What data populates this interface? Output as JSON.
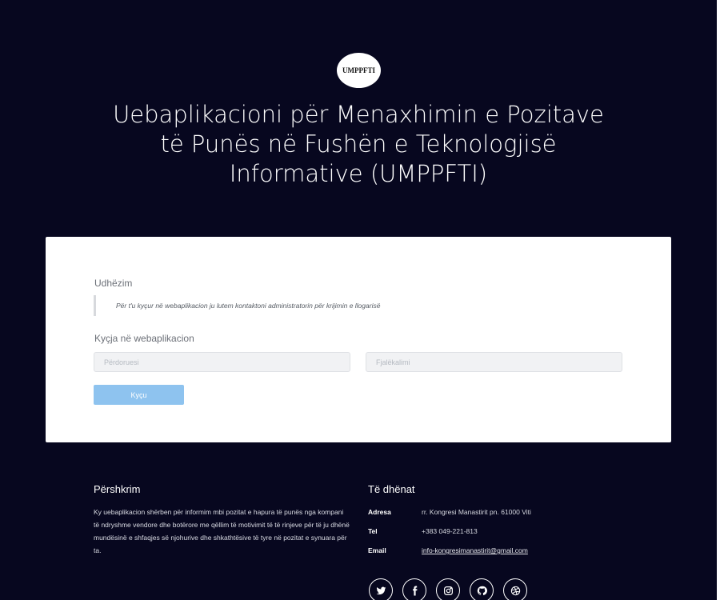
{
  "logo": {
    "text": "UMPPFTI"
  },
  "hero": {
    "title_lines": [
      "Uebaplikacioni për Menaxhimin e Pozitave",
      "të Punës në Fushën e Teknologjisë",
      "Informative (UMPPFTI)"
    ]
  },
  "guide": {
    "label": "Udhëzim",
    "text": "Për t'u kyçur në webaplikacion ju lutem kontaktoni administratorin për krijimin e llogarisë"
  },
  "login": {
    "label": "Kyçja në webaplikacion",
    "username_placeholder": "Përdoruesi",
    "password_placeholder": "Fjalëkalimi",
    "button": "Kyçu"
  },
  "footer": {
    "description_title": "Përshkrim",
    "description": "Ky uebaplikacion shërben për informim mbi pozitat e hapura të punës nga kompani të ndryshme vendore dhe botërore me qëllim të motivimit të të rinjeve për të ju dhënë mundësinë e shfaqjes së njohurive dhe shkathtësive të tyre në pozitat e synuara për ta.",
    "details_title": "Të dhënat",
    "contacts": [
      {
        "key": "Adresa",
        "value": "rr. Kongresi Manastirit pn. 61000 Viti"
      },
      {
        "key": "Tel",
        "value": "+383 049-221-813"
      },
      {
        "key": "Email",
        "value": "info-kongresimanastirit@gmail.com"
      }
    ],
    "social": [
      "twitter-icon",
      "facebook-icon",
      "instagram-icon",
      "github-icon",
      "dribbble-icon"
    ]
  },
  "colors": {
    "background": "#07071f",
    "card": "#ffffff",
    "button": "#8ec3ef"
  }
}
